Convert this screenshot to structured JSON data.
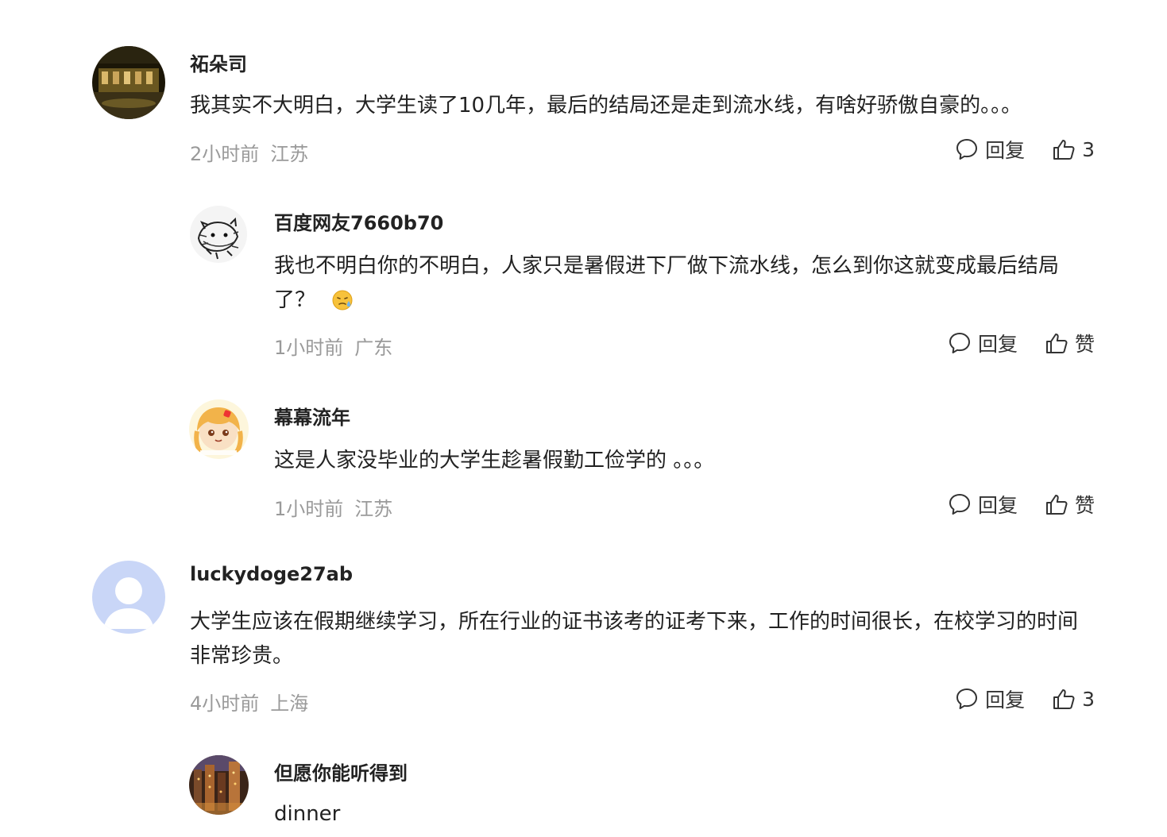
{
  "comments": [
    {
      "username": "祏朵司",
      "avatar_icon": "night-city-photo-avatar",
      "content": "我其实不大明白，大学生读了10几年，最后的结局还是走到流水线，有啥好骄傲自豪的。。。",
      "time": "2小时前",
      "location": "江苏",
      "reply_label": "回复",
      "like_label": "3"
    },
    {
      "username": "百度网友7660b70",
      "avatar_icon": "sketch-bear-avatar",
      "content": "我也不明白你的不明白，人家只是暑假进下厂做下流水线，怎么到你这就变成最后结局了？",
      "emoji": "sweat-emoji",
      "time": "1小时前",
      "location": "广东",
      "reply_label": "回复",
      "like_label": "赞"
    },
    {
      "username": "幕幕流年",
      "avatar_icon": "anime-girl-avatar",
      "content": "这是人家没毕业的大学生趁暑假勤工俭学的 。。。",
      "time": "1小时前",
      "location": "江苏",
      "reply_label": "回复",
      "like_label": "赞"
    },
    {
      "username": "luckydoge27ab",
      "avatar_icon": "default-user-avatar",
      "content": "大学生应该在假期继续学习，所在行业的证书该考的证考下来，工作的时间很长，在校学习的时间非常珍贵。",
      "time": "4小时前",
      "location": "上海",
      "reply_label": "回复",
      "like_label": "3"
    },
    {
      "username": "但愿你能听得到",
      "avatar_icon": "city-lights-avatar",
      "content": "dinner"
    }
  ],
  "colors": {
    "text": "#222222",
    "meta": "#9a9a9a",
    "action": "#333333",
    "default_avatar_bg": "#c9d6f7"
  }
}
